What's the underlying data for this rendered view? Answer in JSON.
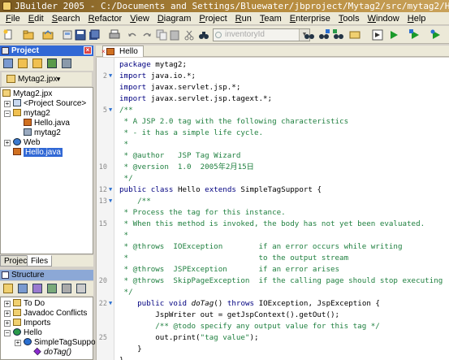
{
  "window": {
    "title": "JBuilder 2005 - C:/Documents and Settings/Bluewater/jbproject/Mytag2/src/mytag2/Hello.java"
  },
  "menu": [
    "File",
    "Edit",
    "Search",
    "Refactor",
    "View",
    "Diagram",
    "Project",
    "Run",
    "Team",
    "Enterprise",
    "Tools",
    "Window",
    "Help"
  ],
  "toolbar": {
    "search_placeholder": "inventoryId"
  },
  "project_panel": {
    "title": "Project",
    "selected_project": "Mytag2.jpx",
    "tree": [
      {
        "label": "Mytag2.jpx"
      },
      {
        "label": "<Project Source>"
      },
      {
        "label": "mytag2"
      },
      {
        "label": "Hello.java"
      },
      {
        "label": "mytag2"
      },
      {
        "label": "Web"
      },
      {
        "label": "Hello.java"
      }
    ],
    "tabs": [
      "Project",
      "Files"
    ]
  },
  "structure_panel": {
    "title": "Structure",
    "tree": [
      {
        "label": "To Do"
      },
      {
        "label": "Javadoc Conflicts"
      },
      {
        "label": "Imports"
      },
      {
        "label": "Hello"
      },
      {
        "label": "SimpleTagSuppor"
      },
      {
        "label": "doTag()"
      }
    ]
  },
  "editor": {
    "tab_label": "Hello",
    "lines": [
      {
        "n": "",
        "fold": false,
        "text": "package mytag2;"
      },
      {
        "n": "2",
        "fold": true,
        "text": "import java.io.*;"
      },
      {
        "n": "",
        "fold": false,
        "text": "import javax.servlet.jsp.*;"
      },
      {
        "n": "",
        "fold": false,
        "text": "import javax.servlet.jsp.tagext.*;"
      },
      {
        "n": "5",
        "fold": true,
        "text": "/**"
      },
      {
        "n": "",
        "fold": false,
        "text": " * A JSP 2.0 tag with the following characteristics"
      },
      {
        "n": "",
        "fold": false,
        "text": " * - it has a simple life cycle."
      },
      {
        "n": "",
        "fold": false,
        "text": " *"
      },
      {
        "n": "",
        "fold": false,
        "text": " * @author   JSP Tag Wizard"
      },
      {
        "n": "10",
        "fold": false,
        "text": " * @version  1.0  2005年2月15日"
      },
      {
        "n": "",
        "fold": false,
        "text": " */"
      },
      {
        "n": "12",
        "fold": true,
        "text": "public class Hello extends SimpleTagSupport {"
      },
      {
        "n": "13",
        "fold": true,
        "text": "    /**"
      },
      {
        "n": "",
        "fold": false,
        "text": " * Process the tag for this instance."
      },
      {
        "n": "15",
        "fold": false,
        "text": " * When this method is invoked, the body has not yet been evaluated."
      },
      {
        "n": "",
        "fold": false,
        "text": " *"
      },
      {
        "n": "",
        "fold": false,
        "text": " * @throws  IOException        if an error occurs while writing"
      },
      {
        "n": "",
        "fold": false,
        "text": " *                             to the output stream"
      },
      {
        "n": "",
        "fold": false,
        "text": " * @throws  JSPException       if an error arises"
      },
      {
        "n": "20",
        "fold": false,
        "text": " * @throws  SkipPageException  if the calling page should stop executing"
      },
      {
        "n": "",
        "fold": false,
        "text": " */"
      },
      {
        "n": "22",
        "fold": true,
        "text": "    public void doTag() throws IOException, JspException {"
      },
      {
        "n": "",
        "fold": false,
        "text": "        JspWriter out = getJspContext().getOut();"
      },
      {
        "n": "",
        "fold": false,
        "text": "        /** @todo specify any output value for this tag */"
      },
      {
        "n": "25",
        "fold": false,
        "text": "        out.print(\"tag value\");"
      },
      {
        "n": "",
        "fold": false,
        "text": "    }"
      },
      {
        "n": "",
        "fold": false,
        "text": "}"
      }
    ]
  }
}
